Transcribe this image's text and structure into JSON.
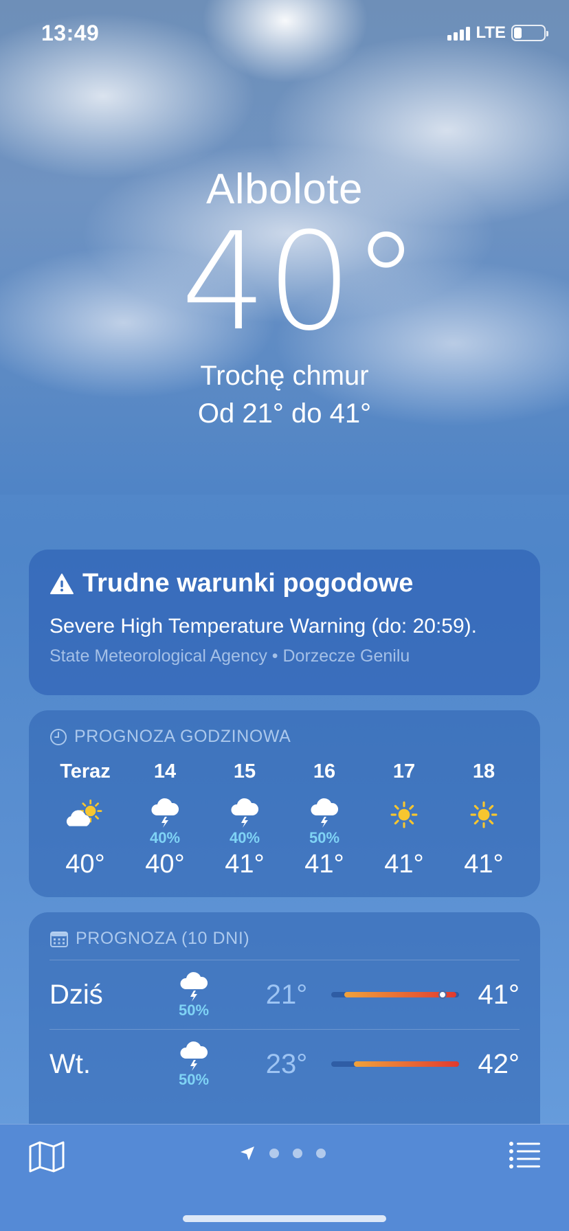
{
  "status_bar": {
    "time": "13:49",
    "network": "LTE",
    "battery_level": 0.25
  },
  "location": {
    "city": "Albolote",
    "temperature": "40°",
    "condition": "Trochę chmur",
    "range": "Od 21°  do 41°"
  },
  "alert": {
    "icon": "warning-triangle-icon",
    "title": "Trudne warunki pogodowe",
    "text": "Severe High Temperature Warning (do: 20:59).",
    "source": "State Meteorological Agency • Dorzecze Genilu"
  },
  "hourly": {
    "icon": "clock-icon",
    "title": "PROGNOZA GODZINOWA",
    "hours": [
      {
        "label": "Teraz",
        "icon": "partly-cloudy-sun-icon",
        "pop": "",
        "temp": "40°"
      },
      {
        "label": "14",
        "icon": "thunderstorm-icon",
        "pop": "40%",
        "temp": "40°"
      },
      {
        "label": "15",
        "icon": "thunderstorm-icon",
        "pop": "40%",
        "temp": "41°"
      },
      {
        "label": "16",
        "icon": "thunderstorm-icon",
        "pop": "50%",
        "temp": "41°"
      },
      {
        "label": "17",
        "icon": "sun-icon",
        "pop": "",
        "temp": "41°"
      },
      {
        "label": "18",
        "icon": "sun-icon",
        "pop": "",
        "temp": "41°"
      }
    ]
  },
  "daily": {
    "icon": "calendar-icon",
    "title": "PROGNOZA (10 DNI)",
    "days": [
      {
        "name": "Dziś",
        "icon": "thunderstorm-icon",
        "pop": "50%",
        "low": "21°",
        "high": "41°",
        "bar_start": 0.1,
        "bar_end": 0.98,
        "current": 0.87
      },
      {
        "name": "Wt.",
        "icon": "thunderstorm-icon",
        "pop": "50%",
        "low": "23°",
        "high": "42°",
        "bar_start": 0.18,
        "bar_end": 1.0
      }
    ]
  },
  "colors": {
    "accent_pop": "#7fd3f5",
    "sun": "#f7c62f",
    "bar_warm": "#f0a23b",
    "bar_hot": "#e03a2f"
  },
  "toolbar": {
    "map_icon": "map-icon",
    "location_icon": "location-arrow-icon",
    "list_icon": "list-icon",
    "pages": 3
  }
}
